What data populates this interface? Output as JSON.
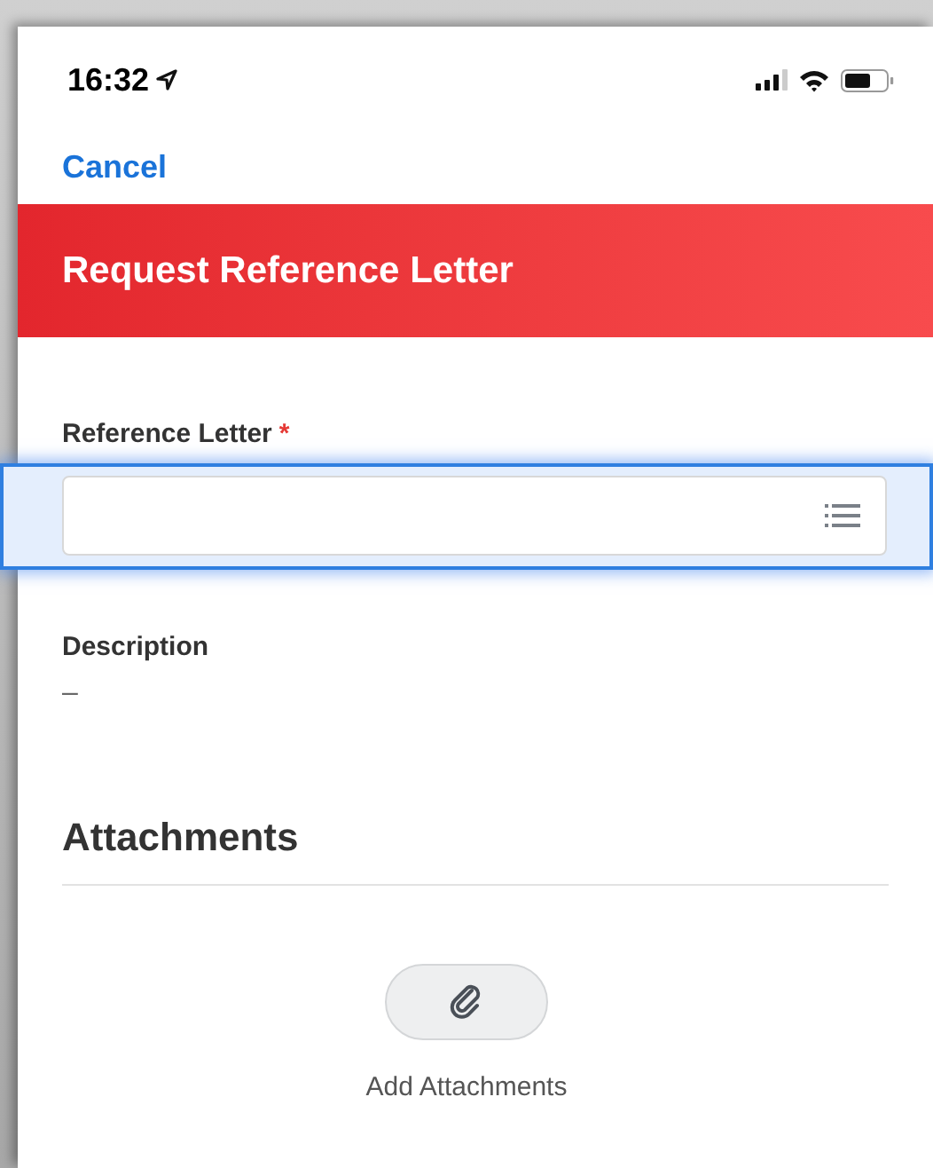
{
  "status_bar": {
    "time": "16:32"
  },
  "nav": {
    "cancel": "Cancel"
  },
  "header": {
    "title": "Request Reference Letter"
  },
  "field": {
    "label": "Reference Letter",
    "required": true,
    "required_mark": "*",
    "focused": true
  },
  "description": {
    "label": "Description",
    "value": "–"
  },
  "attachments": {
    "heading": "Attachments",
    "action": "Add Attachments"
  }
}
